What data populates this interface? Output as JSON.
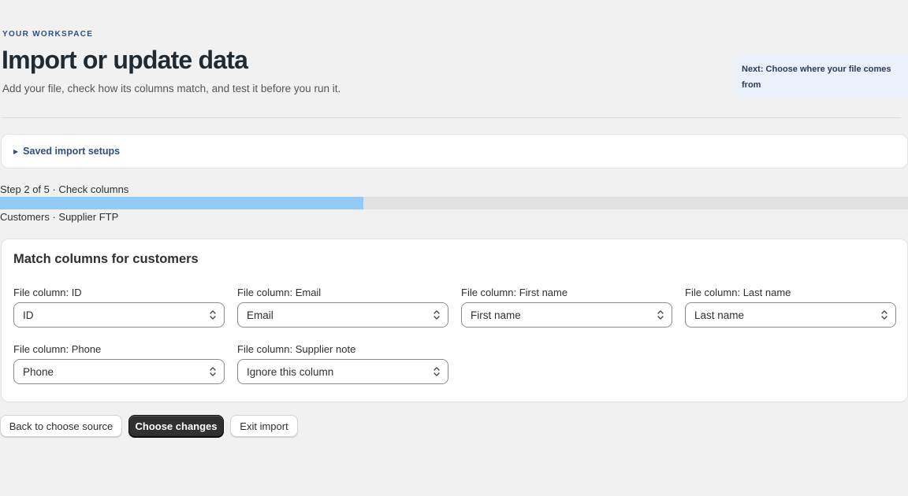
{
  "header": {
    "eyebrow": "YOUR WORKSPACE",
    "title": "Import or update data",
    "subtitle": "Add your file, check how its columns match, and test it before you run it.",
    "next_hint": "Next: Choose where your file comes from"
  },
  "saved_setups": {
    "label": "Saved import setups"
  },
  "progress": {
    "step_label": "Step 2 of 5 · Check columns",
    "fraction": 0.4,
    "context": "Customers · Supplier FTP"
  },
  "match": {
    "title": "Match columns for customers",
    "fields": [
      {
        "label": "File column: ID",
        "value": "ID"
      },
      {
        "label": "File column: Email",
        "value": "Email"
      },
      {
        "label": "File column: First name",
        "value": "First name"
      },
      {
        "label": "File column: Last name",
        "value": "Last name"
      },
      {
        "label": "File column: Phone",
        "value": "Phone"
      },
      {
        "label": "File column: Supplier note",
        "value": "Ignore this column"
      }
    ]
  },
  "actions": {
    "back": "Back to choose source",
    "primary": "Choose changes",
    "exit": "Exit import"
  }
}
